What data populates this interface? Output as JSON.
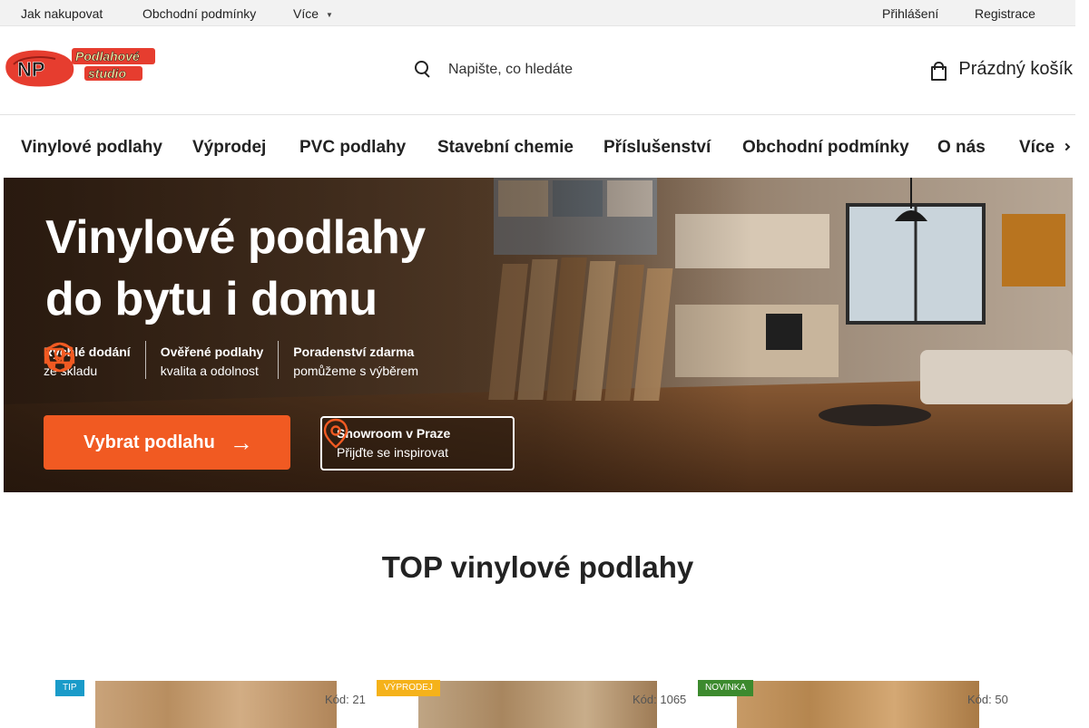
{
  "topbar": {
    "links": [
      "Jak nakupovat",
      "Obchodní podmínky",
      "Více"
    ],
    "login": "Přihlášení",
    "register": "Registrace"
  },
  "header": {
    "logo_text": "NP Podlahové studio",
    "search_placeholder": "Napište, co hledáte",
    "cart_label": "Prázdný košík"
  },
  "nav": {
    "items": [
      "Vinylové podlahy",
      "Výprodej",
      "PVC podlahy",
      "Stavební chemie",
      "Příslušenství",
      "Obchodní podmínky",
      "O nás",
      "Více"
    ]
  },
  "hero": {
    "headline_line1": "Vinylové podlahy",
    "headline_line2": "do bytu i domu",
    "features": [
      {
        "title": "Rychlé dodání",
        "sub": "ze skladu",
        "icon": "truck-icon"
      },
      {
        "title": "Ověřené podlahy",
        "sub": "kvalita a odolnost",
        "icon": "shield-check-icon"
      },
      {
        "title": "Poradenství zdarma",
        "sub": "pomůžeme s výběrem",
        "icon": "user-icon"
      }
    ],
    "cta_label": "Vybrat podlahu",
    "showroom_title": "Showroom v Praze",
    "showroom_sub": "Přijďte se inspirovat"
  },
  "section": {
    "title": "TOP vinylové podlahy"
  },
  "products": [
    {
      "badge": "TIP",
      "badge_color": "#1a9bc9",
      "code": "Kód: 21"
    },
    {
      "badge": "VÝPRODEJ",
      "badge_color": "#f5b21a",
      "code": "Kód: 1065"
    },
    {
      "badge": "NOVINKA",
      "badge_color": "#3c8a2e",
      "code": "Kód: 50"
    }
  ],
  "colors": {
    "accent": "#f15a22",
    "topbar_bg": "#f2f2f2"
  }
}
